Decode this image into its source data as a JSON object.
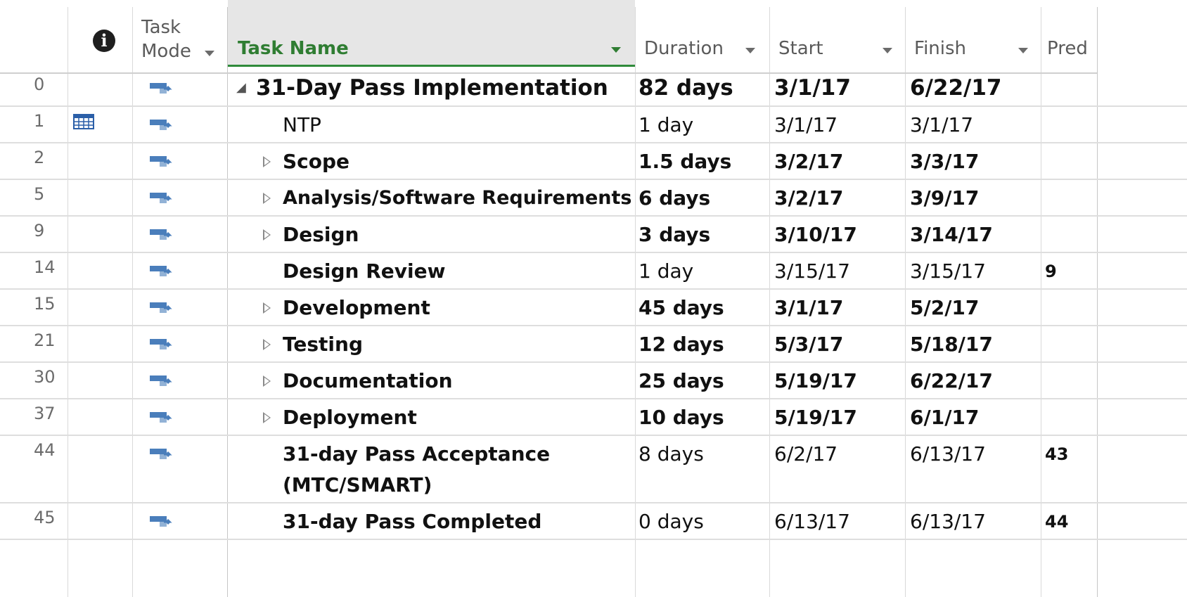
{
  "header": {
    "task_mode_line1": "Task",
    "task_mode_line2": "Mode",
    "task_name": "Task Name",
    "duration": "Duration",
    "start": "Start",
    "finish": "Finish",
    "predecessors": "Pred"
  },
  "icons": {
    "info": "info-icon",
    "task_mode": "auto-scheduled-task-icon",
    "calendar": "calendar-indicator-icon",
    "expand": "expand-triangle-icon",
    "collapse": "collapse-triangle-icon"
  },
  "colors": {
    "accent_green": "#2f7d32",
    "task_mode_blue": "#4a7ebb"
  },
  "rows": [
    {
      "id": "0",
      "name": "31-Day Pass Implementation",
      "duration": "82 days",
      "start": "3/1/17",
      "finish": "6/22/17",
      "pred": "",
      "bold": true,
      "summary_root": true,
      "expandable": false,
      "indicator": ""
    },
    {
      "id": "1",
      "name": "NTP",
      "duration": "1 day",
      "start": "3/1/17",
      "finish": "3/1/17",
      "pred": "",
      "bold": false,
      "expandable": false,
      "indicator": "calendar"
    },
    {
      "id": "2",
      "name": "Scope",
      "duration": "1.5 days",
      "start": "3/2/17",
      "finish": "3/3/17",
      "pred": "",
      "bold": true,
      "expandable": true
    },
    {
      "id": "5",
      "name": "Analysis/Software Requirements",
      "duration": "6 days",
      "start": "3/2/17",
      "finish": "3/9/17",
      "pred": "",
      "bold": true,
      "expandable": true
    },
    {
      "id": "9",
      "name": "Design",
      "duration": "3 days",
      "start": "3/10/17",
      "finish": "3/14/17",
      "pred": "",
      "bold": true,
      "expandable": true
    },
    {
      "id": "14",
      "name": "Design Review",
      "duration": "1 day",
      "start": "3/15/17",
      "finish": "3/15/17",
      "pred": "9",
      "bold": false,
      "name_bold": true,
      "expandable": false
    },
    {
      "id": "15",
      "name": "Development",
      "duration": "45 days",
      "start": "3/1/17",
      "finish": "5/2/17",
      "pred": "",
      "bold": true,
      "expandable": true
    },
    {
      "id": "21",
      "name": "Testing",
      "duration": "12 days",
      "start": "5/3/17",
      "finish": "5/18/17",
      "pred": "",
      "bold": true,
      "expandable": true
    },
    {
      "id": "30",
      "name": "Documentation",
      "duration": "25 days",
      "start": "5/19/17",
      "finish": "6/22/17",
      "pred": "",
      "bold": true,
      "expandable": true
    },
    {
      "id": "37",
      "name": "Deployment",
      "duration": "10 days",
      "start": "5/19/17",
      "finish": "6/1/17",
      "pred": "",
      "bold": true,
      "expandable": true
    },
    {
      "id": "44",
      "name_line1": "31-day Pass Acceptance",
      "name_line2": "(MTC/SMART)",
      "duration": "8 days",
      "start": "6/2/17",
      "finish": "6/13/17",
      "pred": "43",
      "bold": false,
      "name_bold": true,
      "expandable": false
    },
    {
      "id": "45",
      "name": "31-day Pass Completed",
      "duration": "0 days",
      "start": "6/13/17",
      "finish": "6/13/17",
      "pred": "44",
      "bold": false,
      "name_bold": true,
      "expandable": false
    }
  ]
}
